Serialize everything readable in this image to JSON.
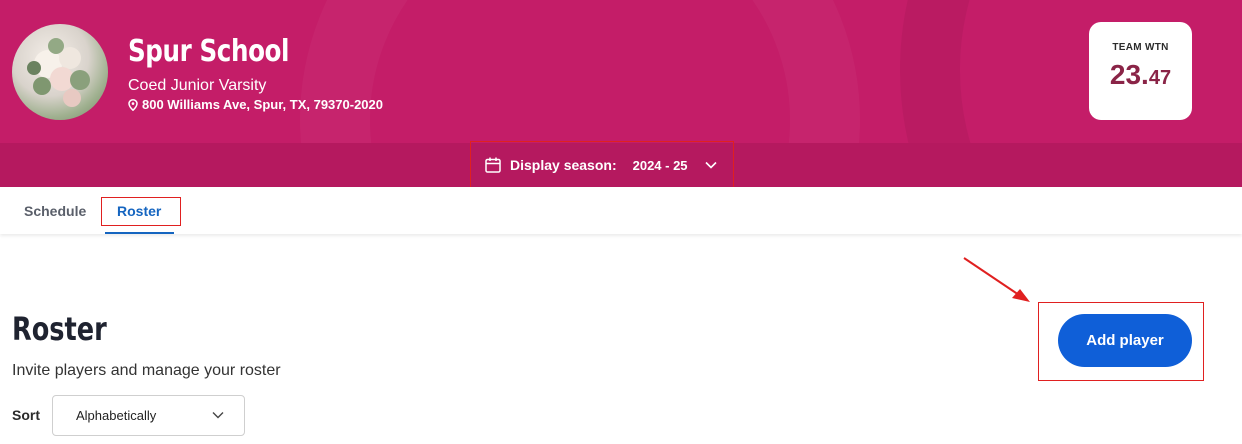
{
  "team": {
    "name": "Spur School",
    "division": "Coed Junior Varsity",
    "address": "800 Williams Ave, Spur, TX, 79370-2020"
  },
  "wtn": {
    "label": "TEAM WTN",
    "value_int": "23.",
    "value_dec": "47"
  },
  "season": {
    "label": "Display season:",
    "value": "2024 - 25"
  },
  "tabs": [
    {
      "label": "Schedule",
      "active": false
    },
    {
      "label": "Roster",
      "active": true
    }
  ],
  "main": {
    "title": "Roster",
    "subtitle": "Invite players and manage your roster",
    "sort_label": "Sort",
    "sort_value": "Alphabetically",
    "add_button": "Add player"
  },
  "colors": {
    "banner": "#c41d68",
    "accent": "#0f5fd8",
    "annotation": "#e02020"
  },
  "icons": {
    "location": "pin-icon",
    "calendar": "calendar-icon",
    "dropdown": "chevron-down-icon"
  }
}
